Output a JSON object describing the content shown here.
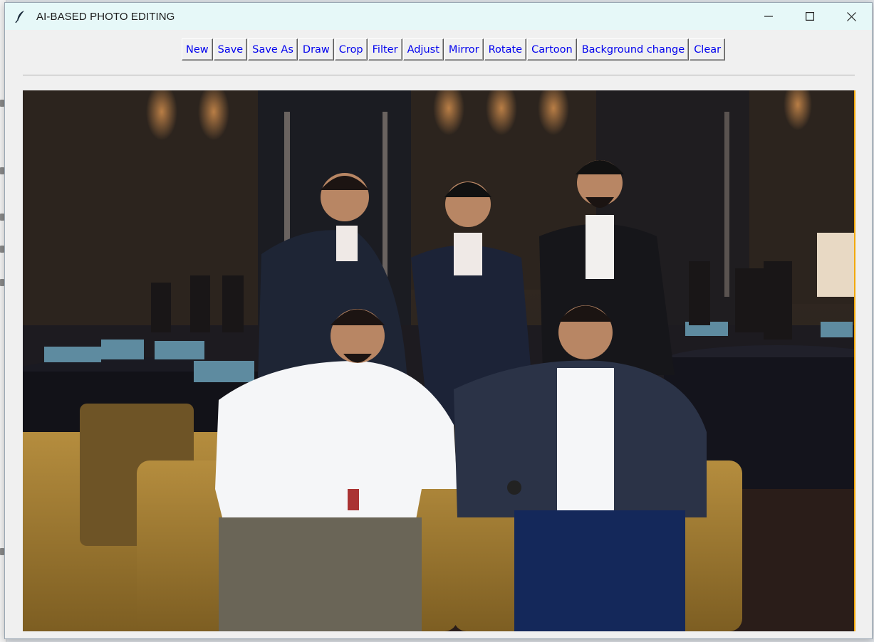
{
  "window": {
    "title": "AI-BASED PHOTO EDITING",
    "icon": "feather-icon"
  },
  "toolbar": {
    "buttons": [
      {
        "label": "New"
      },
      {
        "label": "Save"
      },
      {
        "label": "Save As"
      },
      {
        "label": "Draw"
      },
      {
        "label": "Crop"
      },
      {
        "label": "Filter"
      },
      {
        "label": "Adjust"
      },
      {
        "label": "Mirror"
      },
      {
        "label": "Rotate"
      },
      {
        "label": "Cartoon"
      },
      {
        "label": "Background change"
      },
      {
        "label": "Clear"
      }
    ]
  },
  "canvas": {
    "content": "group-photo",
    "accent_border": "#f2a90c"
  },
  "colors": {
    "titlebar": "#e6f8f8",
    "button_text": "#0000ee",
    "window_bg": "#f0f0f0"
  }
}
